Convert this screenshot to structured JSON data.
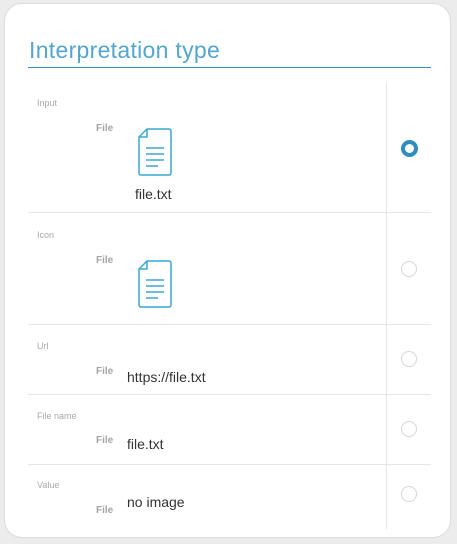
{
  "panel": {
    "title": "Interpretation type"
  },
  "options": [
    {
      "type_label": "Input",
      "file_label": "File",
      "icon": "document-icon",
      "caption": "file.txt",
      "selected": true
    },
    {
      "type_label": "Icon",
      "file_label": "File",
      "icon": "document-icon",
      "selected": false
    },
    {
      "type_label": "Url",
      "file_label": "File",
      "value": "https://file.txt",
      "selected": false
    },
    {
      "type_label": "File name",
      "file_label": "File",
      "value": "file.txt",
      "selected": false
    },
    {
      "type_label": "Value",
      "file_label": "File",
      "value": "no image",
      "selected": false
    }
  ],
  "colors": {
    "accent": "#2e8fbd",
    "title": "#52a6cf",
    "icon": "#3aa5d6"
  }
}
